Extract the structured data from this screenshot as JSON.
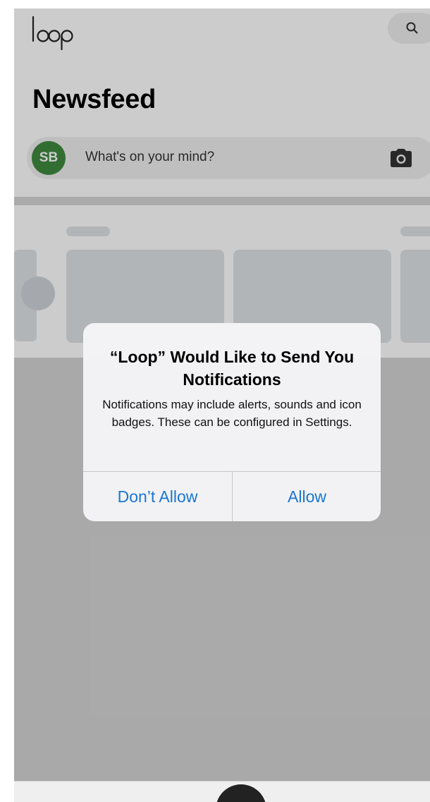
{
  "app": {
    "logo_text": "loop",
    "logo_color": "#222222"
  },
  "header": {
    "title": "Newsfeed",
    "search_icon": "search-icon"
  },
  "composer": {
    "avatar_initials": "SB",
    "avatar_color": "#3f8a3f",
    "placeholder": "What's on your mind?",
    "camera_icon": "camera-icon"
  },
  "alert": {
    "title": "“Loop” Would Like to Send You Notifications",
    "message": "Notifications may include alerts, sounds and icon badges. These can be configured in Settings.",
    "dont_allow_label": "Don’t Allow",
    "allow_label": "Allow",
    "button_color": "#1976d2"
  }
}
